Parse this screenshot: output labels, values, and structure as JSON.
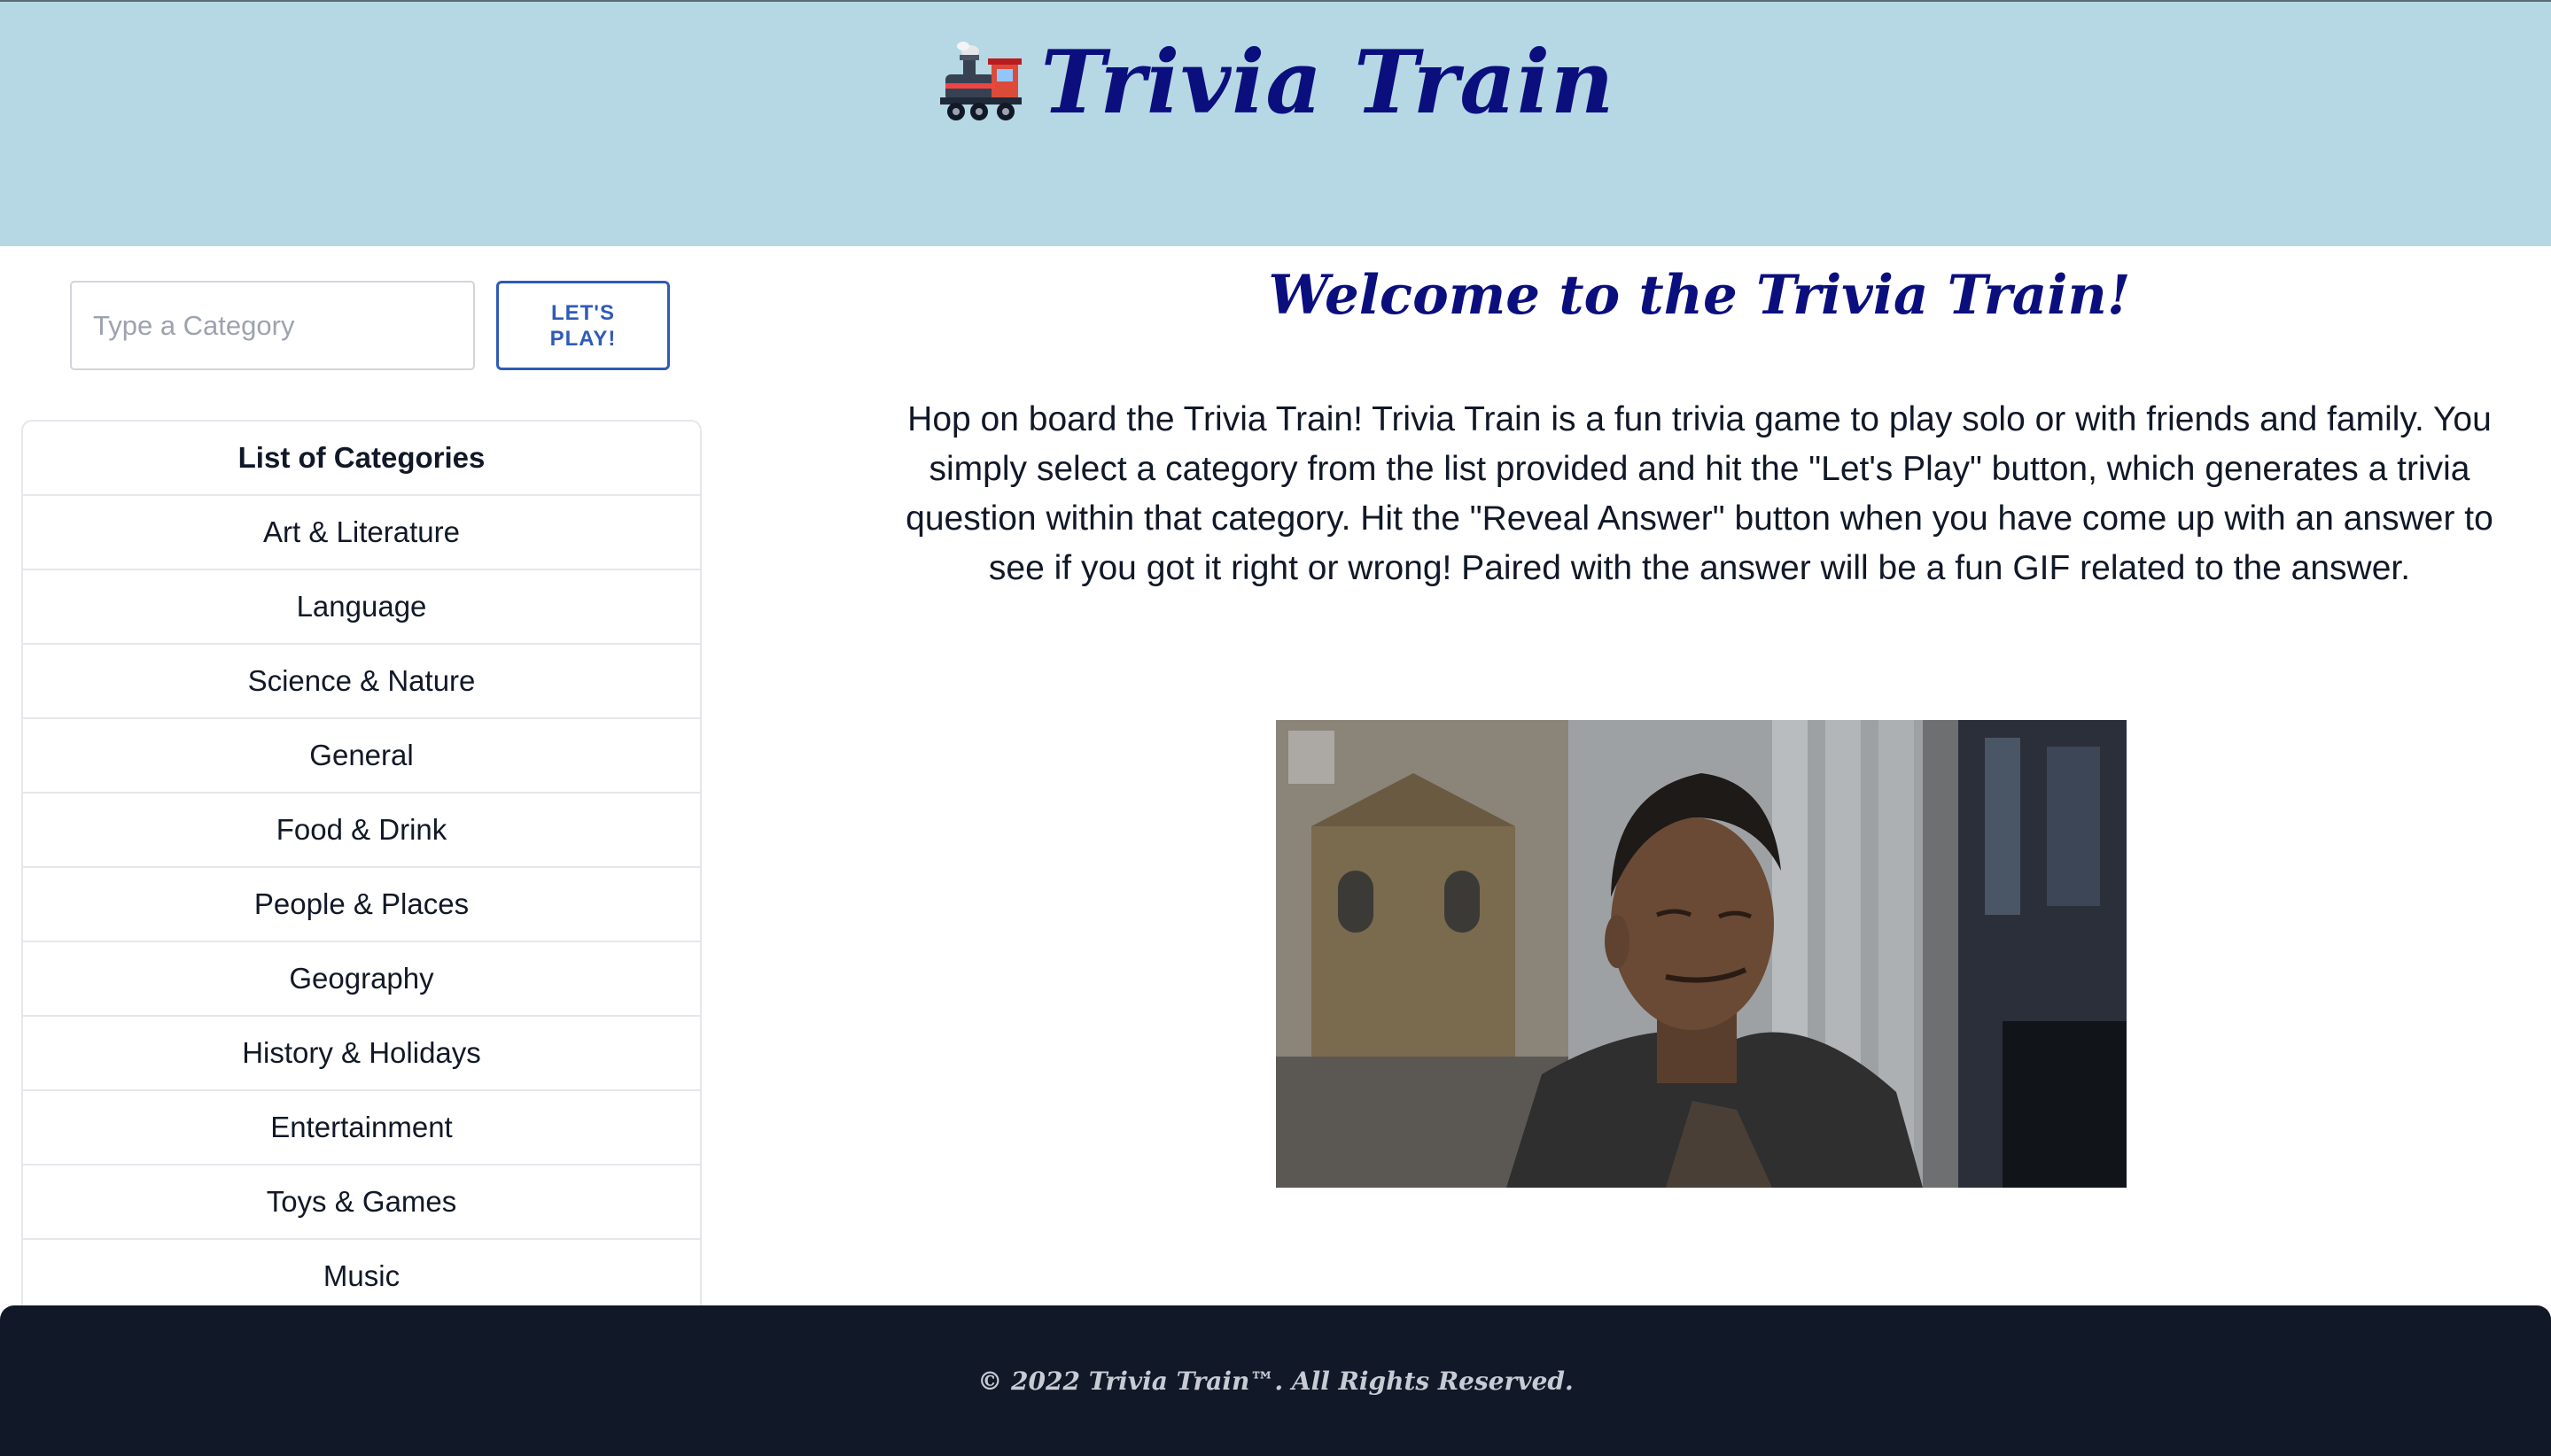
{
  "header": {
    "icon": "locomotive-icon",
    "title": "Trivia Train",
    "background_color": "#b6d7e4",
    "title_color": "#0b0f7e"
  },
  "search": {
    "placeholder": "Type a Category",
    "value": ""
  },
  "play_button": {
    "label": "LET'S PLAY!",
    "color": "#2f5bb7"
  },
  "categories": {
    "heading": "List of Categories",
    "items": [
      "Art & Literature",
      "Language",
      "Science & Nature",
      "General",
      "Food & Drink",
      "People & Places",
      "Geography",
      "History & Holidays",
      "Entertainment",
      "Toys & Games",
      "Music"
    ]
  },
  "main": {
    "welcome": "Welcome to the Trivia Train!",
    "intro": "Hop on board the Trivia Train! Trivia Train is a fun trivia game to play solo or with friends and family. You simply select a category from the list provided and hit the \"Let's Play\" button, which generates a trivia question within that category. Hit the \"Reveal Answer\" button when you have come up with an answer to see if you got it right or wrong! Paired with the answer will be a fun GIF related to the answer.",
    "gif_icon": "gif-image"
  },
  "footer": {
    "copyright": "© 2022 Trivia Train™. All Rights Reserved.",
    "background_color": "#111827"
  }
}
